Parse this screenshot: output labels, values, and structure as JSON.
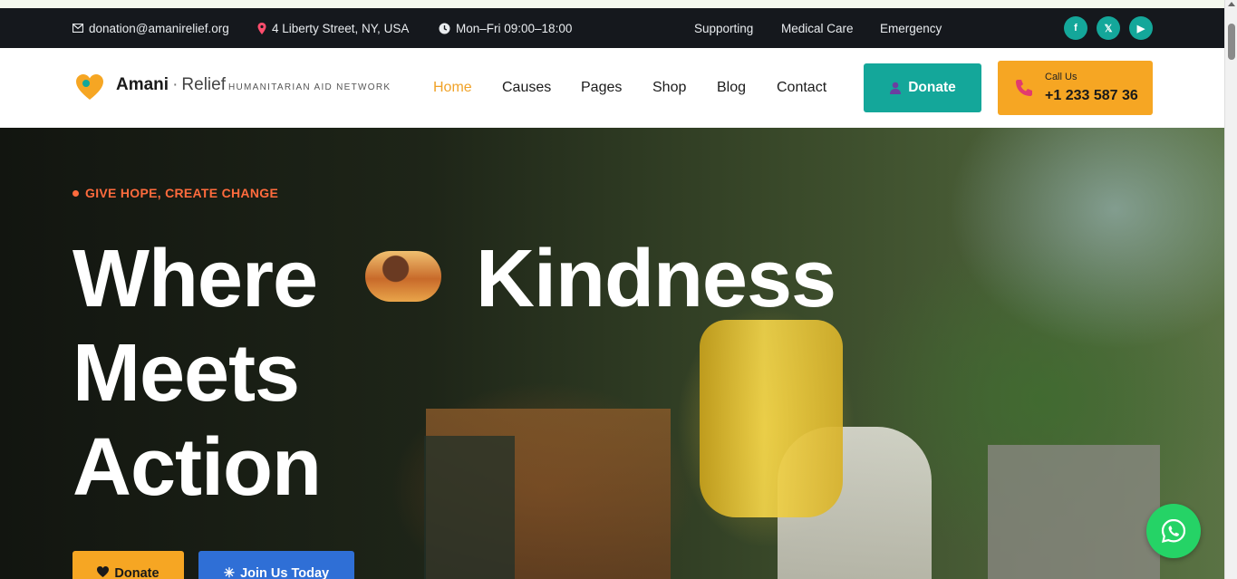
{
  "topbar": {
    "email": "donation@amanirelief.org",
    "address": "4 Liberty Street, NY, USA",
    "hours": "Mon–Fri 09:00–18:00",
    "links": [
      "Supporting",
      "Medical Care",
      "Emergency"
    ],
    "social": [
      "f",
      "𝕏",
      "▶"
    ]
  },
  "header": {
    "brand_name": "Amani",
    "brand_separator": "·",
    "brand_sub": "Relief",
    "brand_tagline": "HUMANITARIAN AID NETWORK",
    "nav": [
      "Home",
      "Causes",
      "Pages",
      "Shop",
      "Blog",
      "Contact"
    ],
    "active_nav": "Home",
    "donate_label": "Donate",
    "call_label": "Call Us",
    "call_number": "+1 233 587 36"
  },
  "hero": {
    "kicker": "GIVE HOPE, CREATE CHANGE",
    "line1_a": "Where",
    "line1_b": "Kindness",
    "line2": "Meets",
    "line3": "Action",
    "btn_donate": "Donate",
    "btn_join": "Join Us Today"
  },
  "colors": {
    "accent_orange": "#f6a623",
    "teal": "#14a79a",
    "kicker": "#ff6b3d",
    "join_blue": "#2f6fd6",
    "whatsapp": "#25d366"
  },
  "icons": [
    "mail-icon",
    "location-pin-icon",
    "clock-icon",
    "facebook-icon",
    "x-icon",
    "youtube-icon",
    "heart-logo-icon",
    "user-icon",
    "phone-icon",
    "heart-icon",
    "sparkle-icon",
    "whatsapp-icon"
  ]
}
